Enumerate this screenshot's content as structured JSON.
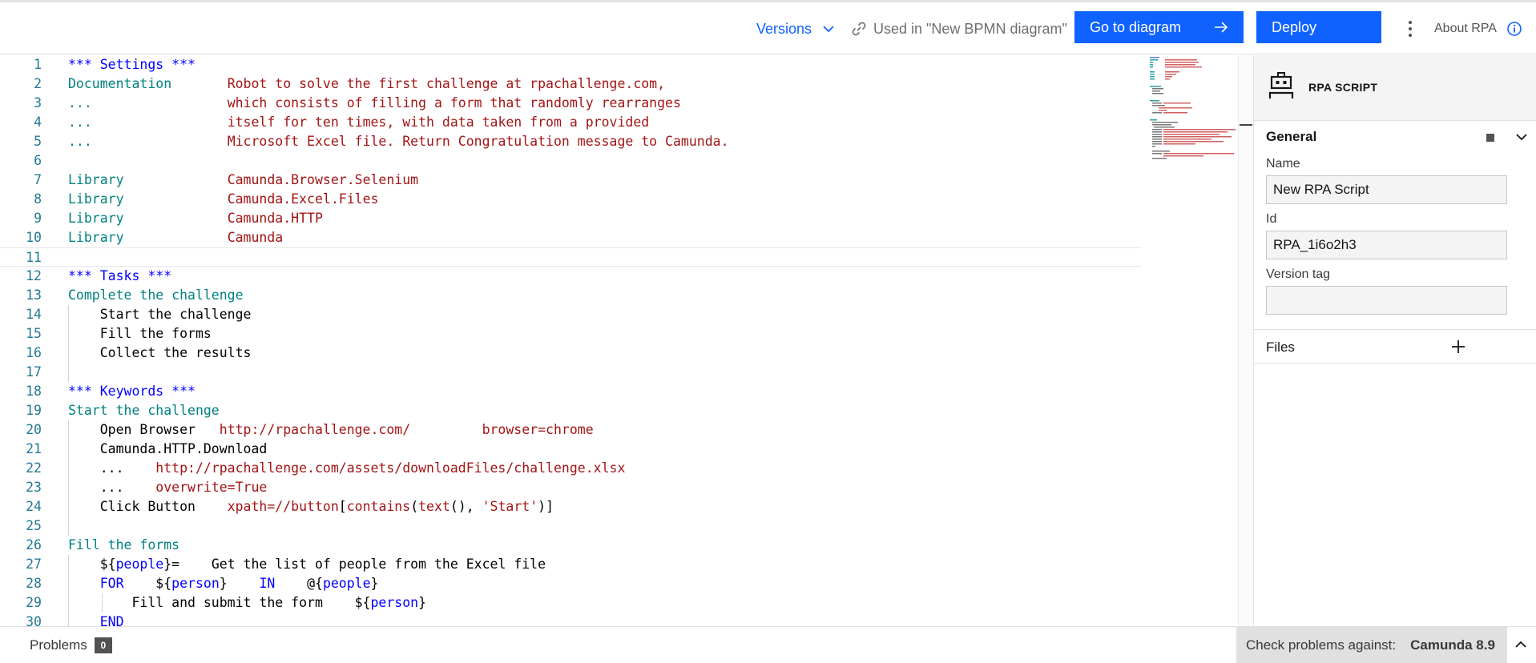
{
  "toolbar": {
    "versions_label": "Versions",
    "used_in_label": "Used in \"New BPMN diagram\"",
    "goto_label": "Go to diagram",
    "deploy_label": "Deploy",
    "about_label": "About RPA",
    "accent_color": "#0f62fe"
  },
  "editor": {
    "lines": [
      {
        "n": "1",
        "guides": 0,
        "tokens": [
          {
            "t": "*** Settings ***",
            "c": "hdr"
          }
        ]
      },
      {
        "n": "2",
        "guides": 0,
        "tokens": [
          {
            "t": "Documentation       ",
            "c": "setting"
          },
          {
            "t": "Robot to solve the first challenge at rpachallenge.com,",
            "c": "val"
          }
        ]
      },
      {
        "n": "3",
        "guides": 0,
        "tokens": [
          {
            "t": "...                 ",
            "c": "setting"
          },
          {
            "t": "which consists of filling a form that randomly rearranges",
            "c": "val"
          }
        ]
      },
      {
        "n": "4",
        "guides": 0,
        "tokens": [
          {
            "t": "...                 ",
            "c": "setting"
          },
          {
            "t": "itself for ten times, with data taken from a provided",
            "c": "val"
          }
        ]
      },
      {
        "n": "5",
        "guides": 0,
        "tokens": [
          {
            "t": "...                 ",
            "c": "setting"
          },
          {
            "t": "Microsoft Excel file. Return Congratulation message to Camunda.",
            "c": "val"
          }
        ]
      },
      {
        "n": "6",
        "guides": 0,
        "tokens": []
      },
      {
        "n": "7",
        "guides": 0,
        "tokens": [
          {
            "t": "Library             ",
            "c": "setting"
          },
          {
            "t": "Camunda.Browser.Selenium",
            "c": "val"
          }
        ]
      },
      {
        "n": "8",
        "guides": 0,
        "tokens": [
          {
            "t": "Library             ",
            "c": "setting"
          },
          {
            "t": "Camunda.Excel.Files",
            "c": "val"
          }
        ]
      },
      {
        "n": "9",
        "guides": 0,
        "tokens": [
          {
            "t": "Library             ",
            "c": "setting"
          },
          {
            "t": "Camunda.HTTP",
            "c": "val"
          }
        ]
      },
      {
        "n": "10",
        "guides": 0,
        "tokens": [
          {
            "t": "Library             ",
            "c": "setting"
          },
          {
            "t": "Camunda",
            "c": "val"
          }
        ]
      },
      {
        "n": "11",
        "guides": 0,
        "active": true,
        "tokens": []
      },
      {
        "n": "12",
        "guides": 0,
        "tokens": [
          {
            "t": "*** Tasks ***",
            "c": "hdr"
          }
        ]
      },
      {
        "n": "13",
        "guides": 0,
        "tokens": [
          {
            "t": "Complete the challenge",
            "c": "setting"
          }
        ]
      },
      {
        "n": "14",
        "guides": 1,
        "tokens": [
          {
            "t": "    Start the challenge",
            "c": "plain"
          }
        ]
      },
      {
        "n": "15",
        "guides": 1,
        "tokens": [
          {
            "t": "    Fill the forms",
            "c": "plain"
          }
        ]
      },
      {
        "n": "16",
        "guides": 1,
        "tokens": [
          {
            "t": "    Collect the results",
            "c": "plain"
          }
        ]
      },
      {
        "n": "17",
        "guides": 1,
        "tokens": []
      },
      {
        "n": "18",
        "guides": 0,
        "tokens": [
          {
            "t": "*** Keywords ***",
            "c": "hdr"
          }
        ]
      },
      {
        "n": "19",
        "guides": 0,
        "tokens": [
          {
            "t": "Start the challenge",
            "c": "setting"
          }
        ]
      },
      {
        "n": "20",
        "guides": 1,
        "tokens": [
          {
            "t": "    Open Browser   ",
            "c": "plain"
          },
          {
            "t": "http://rpachallenge.com/         browser=chrome",
            "c": "val"
          }
        ]
      },
      {
        "n": "21",
        "guides": 1,
        "tokens": [
          {
            "t": "    Camunda.HTTP.Download",
            "c": "plain"
          }
        ]
      },
      {
        "n": "22",
        "guides": 1,
        "tokens": [
          {
            "t": "    ...    ",
            "c": "plain"
          },
          {
            "t": "http://rpachallenge.com/assets/downloadFiles/challenge.xlsx",
            "c": "val"
          }
        ]
      },
      {
        "n": "23",
        "guides": 1,
        "tokens": [
          {
            "t": "    ...    ",
            "c": "plain"
          },
          {
            "t": "overwrite=True",
            "c": "val"
          }
        ]
      },
      {
        "n": "24",
        "guides": 1,
        "tokens": [
          {
            "t": "    Click Button    ",
            "c": "plain"
          },
          {
            "t": "xpath=//button",
            "c": "val"
          },
          {
            "t": "[",
            "c": "plain"
          },
          {
            "t": "contains",
            "c": "val"
          },
          {
            "t": "(",
            "c": "plain"
          },
          {
            "t": "text",
            "c": "val"
          },
          {
            "t": "(), ",
            "c": "plain"
          },
          {
            "t": "'Start'",
            "c": "val"
          },
          {
            "t": ")]",
            "c": "plain"
          }
        ]
      },
      {
        "n": "25",
        "guides": 1,
        "tokens": []
      },
      {
        "n": "26",
        "guides": 0,
        "tokens": [
          {
            "t": "Fill the forms",
            "c": "setting"
          }
        ]
      },
      {
        "n": "27",
        "guides": 1,
        "tokens": [
          {
            "t": "    ${",
            "c": "plain"
          },
          {
            "t": "people",
            "c": "var"
          },
          {
            "t": "}=    Get the list of people from the Excel file",
            "c": "plain"
          }
        ]
      },
      {
        "n": "28",
        "guides": 1,
        "tokens": [
          {
            "t": "    ",
            "c": "plain"
          },
          {
            "t": "FOR",
            "c": "kw"
          },
          {
            "t": "    ${",
            "c": "plain"
          },
          {
            "t": "person",
            "c": "var"
          },
          {
            "t": "}    ",
            "c": "plain"
          },
          {
            "t": "IN",
            "c": "kw"
          },
          {
            "t": "    @{",
            "c": "plain"
          },
          {
            "t": "people",
            "c": "var"
          },
          {
            "t": "}",
            "c": "plain"
          }
        ]
      },
      {
        "n": "29",
        "guides": 2,
        "tokens": [
          {
            "t": "        Fill and submit the form    ${",
            "c": "plain"
          },
          {
            "t": "person",
            "c": "var"
          },
          {
            "t": "}",
            "c": "plain"
          }
        ]
      },
      {
        "n": "30",
        "guides": 1,
        "tokens": [
          {
            "t": "    ",
            "c": "plain"
          },
          {
            "t": "END",
            "c": "kw"
          }
        ]
      }
    ]
  },
  "panel": {
    "type_label": "RPA SCRIPT",
    "general_label": "General",
    "name_label": "Name",
    "name_value": "New RPA Script",
    "id_label": "Id",
    "id_value": "RPA_1i6o2h3",
    "version_tag_label": "Version tag",
    "version_tag_value": "",
    "files_label": "Files"
  },
  "status": {
    "problems_label": "Problems",
    "problems_count": "0",
    "check_label": "Check problems against:",
    "check_version": "Camunda 8.9"
  }
}
